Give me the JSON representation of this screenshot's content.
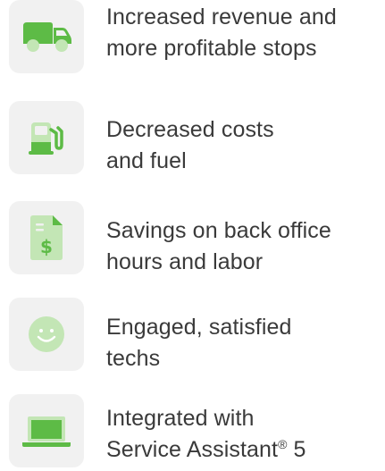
{
  "colors": {
    "tile_background": "#f1f1f1",
    "icon_green_dark": "#5dbb46",
    "icon_green_light": "#c3e6b5",
    "text": "#3a3a3a"
  },
  "benefits": [
    {
      "icon": "delivery-truck-icon",
      "line1": "Increased revenue and",
      "line2": "more profitable stops"
    },
    {
      "icon": "fuel-pump-icon",
      "line1": "Decreased costs",
      "line2": "and fuel"
    },
    {
      "icon": "dollar-document-icon",
      "line1": "Savings on back office",
      "line2": "hours and labor"
    },
    {
      "icon": "smiley-face-icon",
      "line1": "Engaged, satisfied",
      "line2": "techs"
    },
    {
      "icon": "laptop-icon",
      "line1": "Integrated with",
      "line2": "Service Assistant",
      "line2_mark": "®",
      "line2_suffix": " 5"
    }
  ]
}
